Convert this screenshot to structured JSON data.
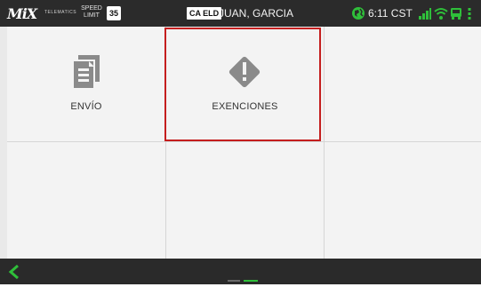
{
  "topbar": {
    "brand": "MiX",
    "brand_sub": "TELEMATICS",
    "speed_label": "SPEED LIMIT",
    "speed_limit": "35",
    "eld_badge": "CA ELD",
    "driver_name": "JUAN, GARCIA",
    "time": "6:11 CST",
    "icons": [
      "timezone-icon",
      "signal-icon",
      "wifi-icon",
      "truck-icon",
      "more-vert-icon"
    ]
  },
  "tiles": [
    {
      "label": "ENVÍO",
      "icon": "documents-icon",
      "selected": false
    },
    {
      "label": "EXENCIONES",
      "icon": "warning-diamond-icon",
      "selected": true
    }
  ],
  "colors": {
    "topbar_bg": "#2b2b2b",
    "bottombar_bg": "#2a2a2a",
    "accent_green": "#2fbf3a",
    "selection_red": "#c41e1e",
    "icon_gray": "#8a8a8a"
  },
  "bottombar": {
    "back_icon": "chevron-left-icon",
    "pager": "page-indicator"
  }
}
